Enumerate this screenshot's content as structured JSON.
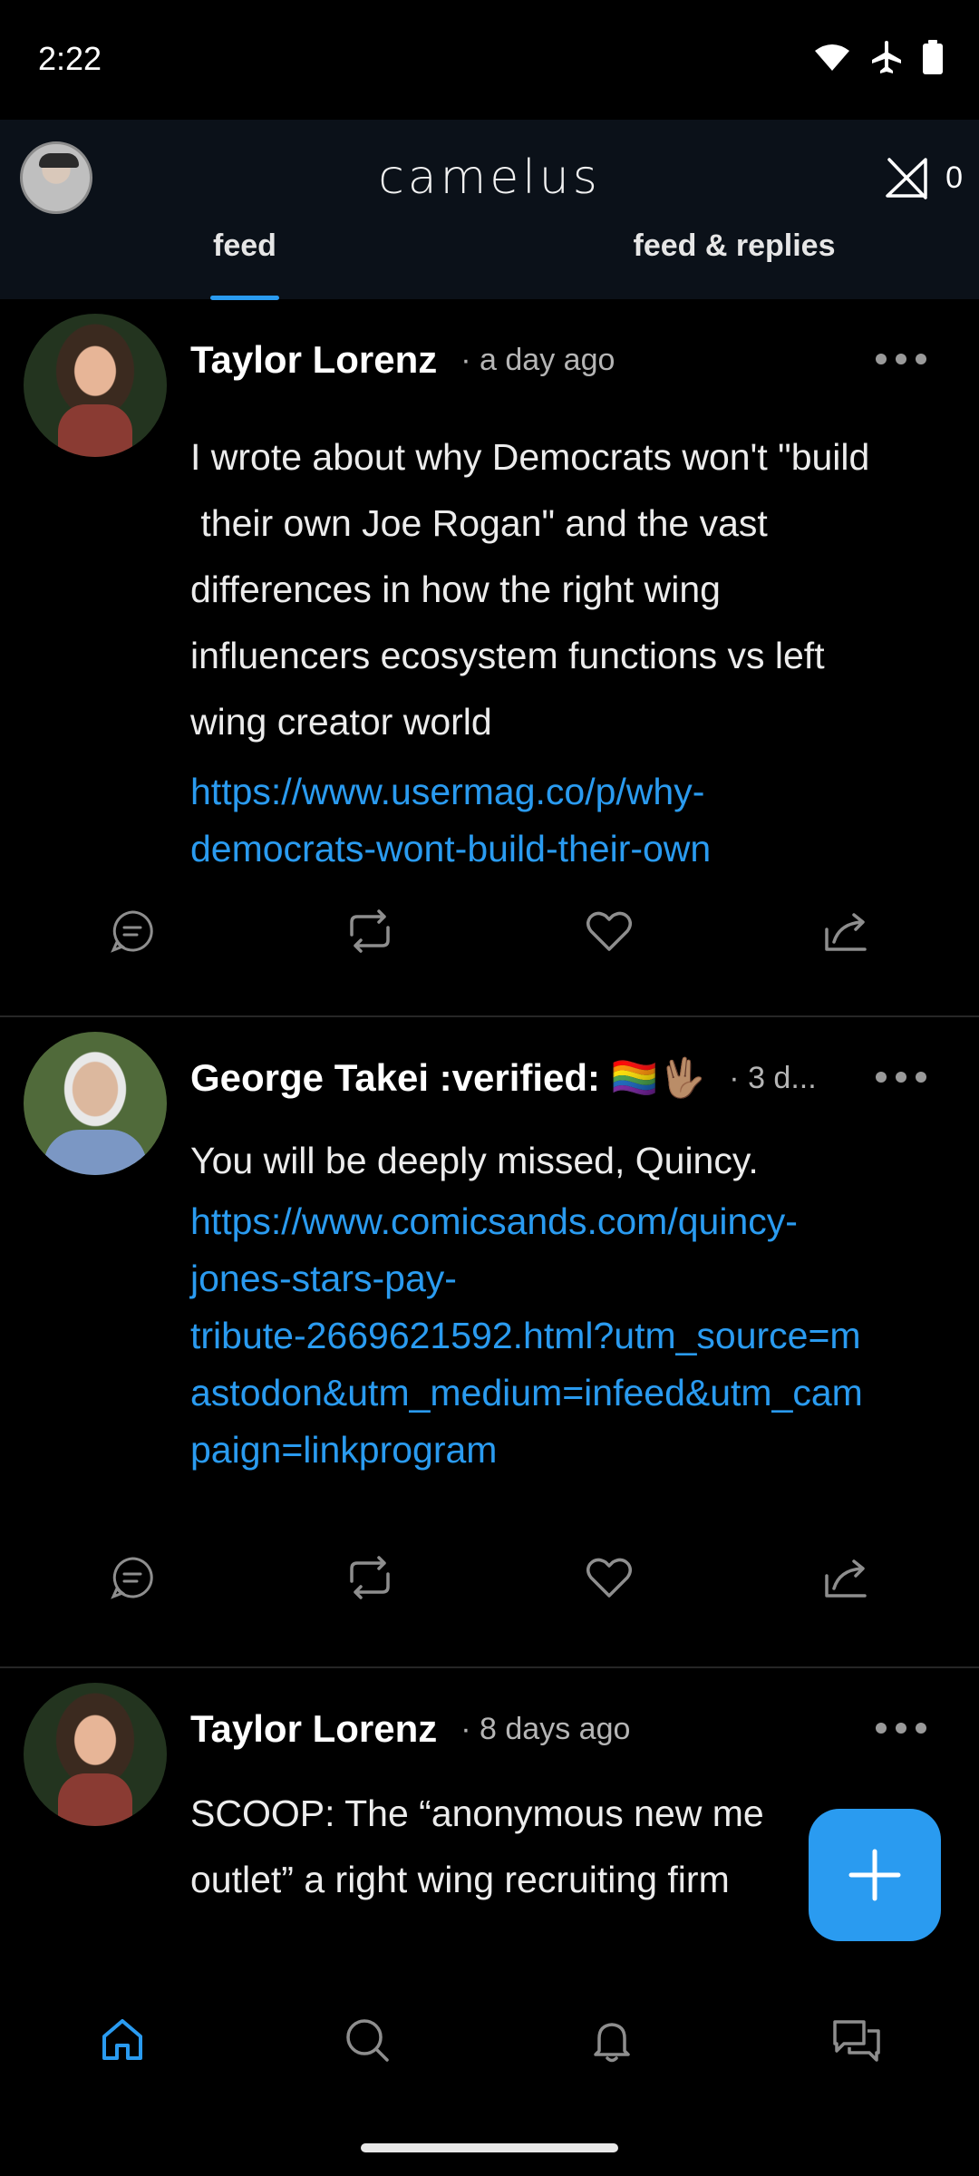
{
  "status_bar": {
    "time": "2:22"
  },
  "app": {
    "title": "camelus",
    "relay_count": "0"
  },
  "tabs": [
    {
      "label": "feed",
      "active": true
    },
    {
      "label": "feed & replies",
      "active": false
    }
  ],
  "posts": [
    {
      "author": "Taylor Lorenz",
      "time": "· a day ago",
      "body_lines": [
        "I wrote about why Democrats won't \"build",
        " their own Joe Rogan\" and the vast",
        "differences in how the right wing",
        "influencers ecosystem functions vs left",
        "wing creator world"
      ],
      "link_lines": [
        "https://www.usermag.co/p/why-",
        "democrats-wont-build-their-own"
      ]
    },
    {
      "author": "George Takei :verified: 🏳️‍🌈🖖🏽",
      "time": "· 3 d...",
      "body_lines": [
        "You will be deeply missed, Quincy."
      ],
      "link_lines": [
        "https://www.comicsands.com/quincy-",
        "jones-stars-pay-",
        "tribute-2669621592.html?utm_source=m",
        "astodon&utm_medium=infeed&utm_cam",
        "paign=linkprogram"
      ]
    },
    {
      "author": "Taylor Lorenz",
      "time": "· 8 days ago",
      "body_lines": [
        "SCOOP: The “anonymous new me",
        "outlet” a right wing recruiting firm"
      ]
    }
  ],
  "colors": {
    "accent": "#2a9bf0",
    "header_bg": "#0b1119",
    "link": "#2a9bf0"
  },
  "icons": {
    "post_actions": [
      "reply-icon",
      "repost-icon",
      "like-icon",
      "share-icon"
    ],
    "bottom_nav": [
      "home-icon",
      "search-icon",
      "notifications-icon",
      "messages-icon"
    ]
  }
}
